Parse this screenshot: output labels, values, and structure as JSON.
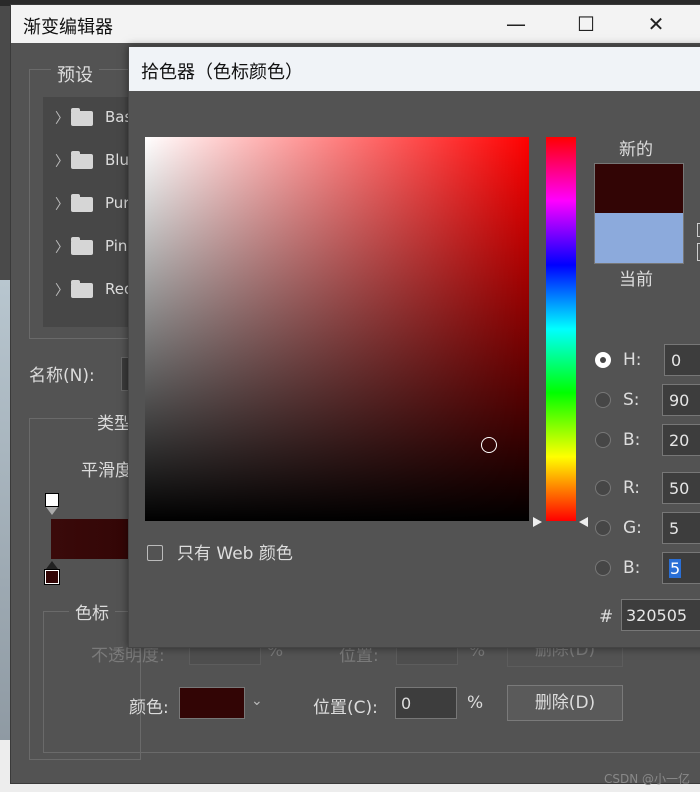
{
  "gradient_editor": {
    "title": "渐变编辑器",
    "presets_label": "预设",
    "presets": [
      {
        "name": "Bas"
      },
      {
        "name": "Blu"
      },
      {
        "name": "Pur"
      },
      {
        "name": "Pin"
      },
      {
        "name": "Red"
      }
    ],
    "name_label": "名称(N):",
    "type_label": "类型",
    "smooth_label": "平滑度",
    "stops_label": "色标",
    "opacity_label": "不透明度:",
    "opacity_unit": "%",
    "opacity_position_label": "位置:",
    "opacity_position_unit": "%",
    "opacity_delete_label": "删除(D)",
    "color_label": "颜色:",
    "color_value": "#320505",
    "position_label": "位置(C):",
    "position_value": "0",
    "position_unit": "%",
    "delete_label": "删除(D)"
  },
  "color_picker": {
    "title": "拾色器（色标颜色）",
    "hue_value": 0,
    "web_colors_label": "只有 Web 颜色",
    "new_label": "新的",
    "current_label": "当前",
    "new_color": "#320505",
    "current_color": "#8caadc",
    "channels": [
      {
        "label": "H:",
        "value": "0",
        "selected": true
      },
      {
        "label": "S:",
        "value": "90",
        "selected": false
      },
      {
        "label": "B:",
        "value": "20",
        "selected": false
      },
      {
        "label": "R:",
        "value": "50",
        "selected": false
      },
      {
        "label": "G:",
        "value": "5",
        "selected": false
      },
      {
        "label": "B:",
        "value": "5",
        "selected": false
      }
    ],
    "hex_prefix": "#",
    "hex_value": "320505"
  },
  "watermark": "CSDN @小一亿",
  "icons": {
    "minimize": "minimize-icon",
    "maximize": "maximize-icon",
    "close": "close-icon",
    "folder": "folder-icon",
    "chevron_right": "chevron-right-icon",
    "chevron_down": "chevron-down-icon"
  }
}
